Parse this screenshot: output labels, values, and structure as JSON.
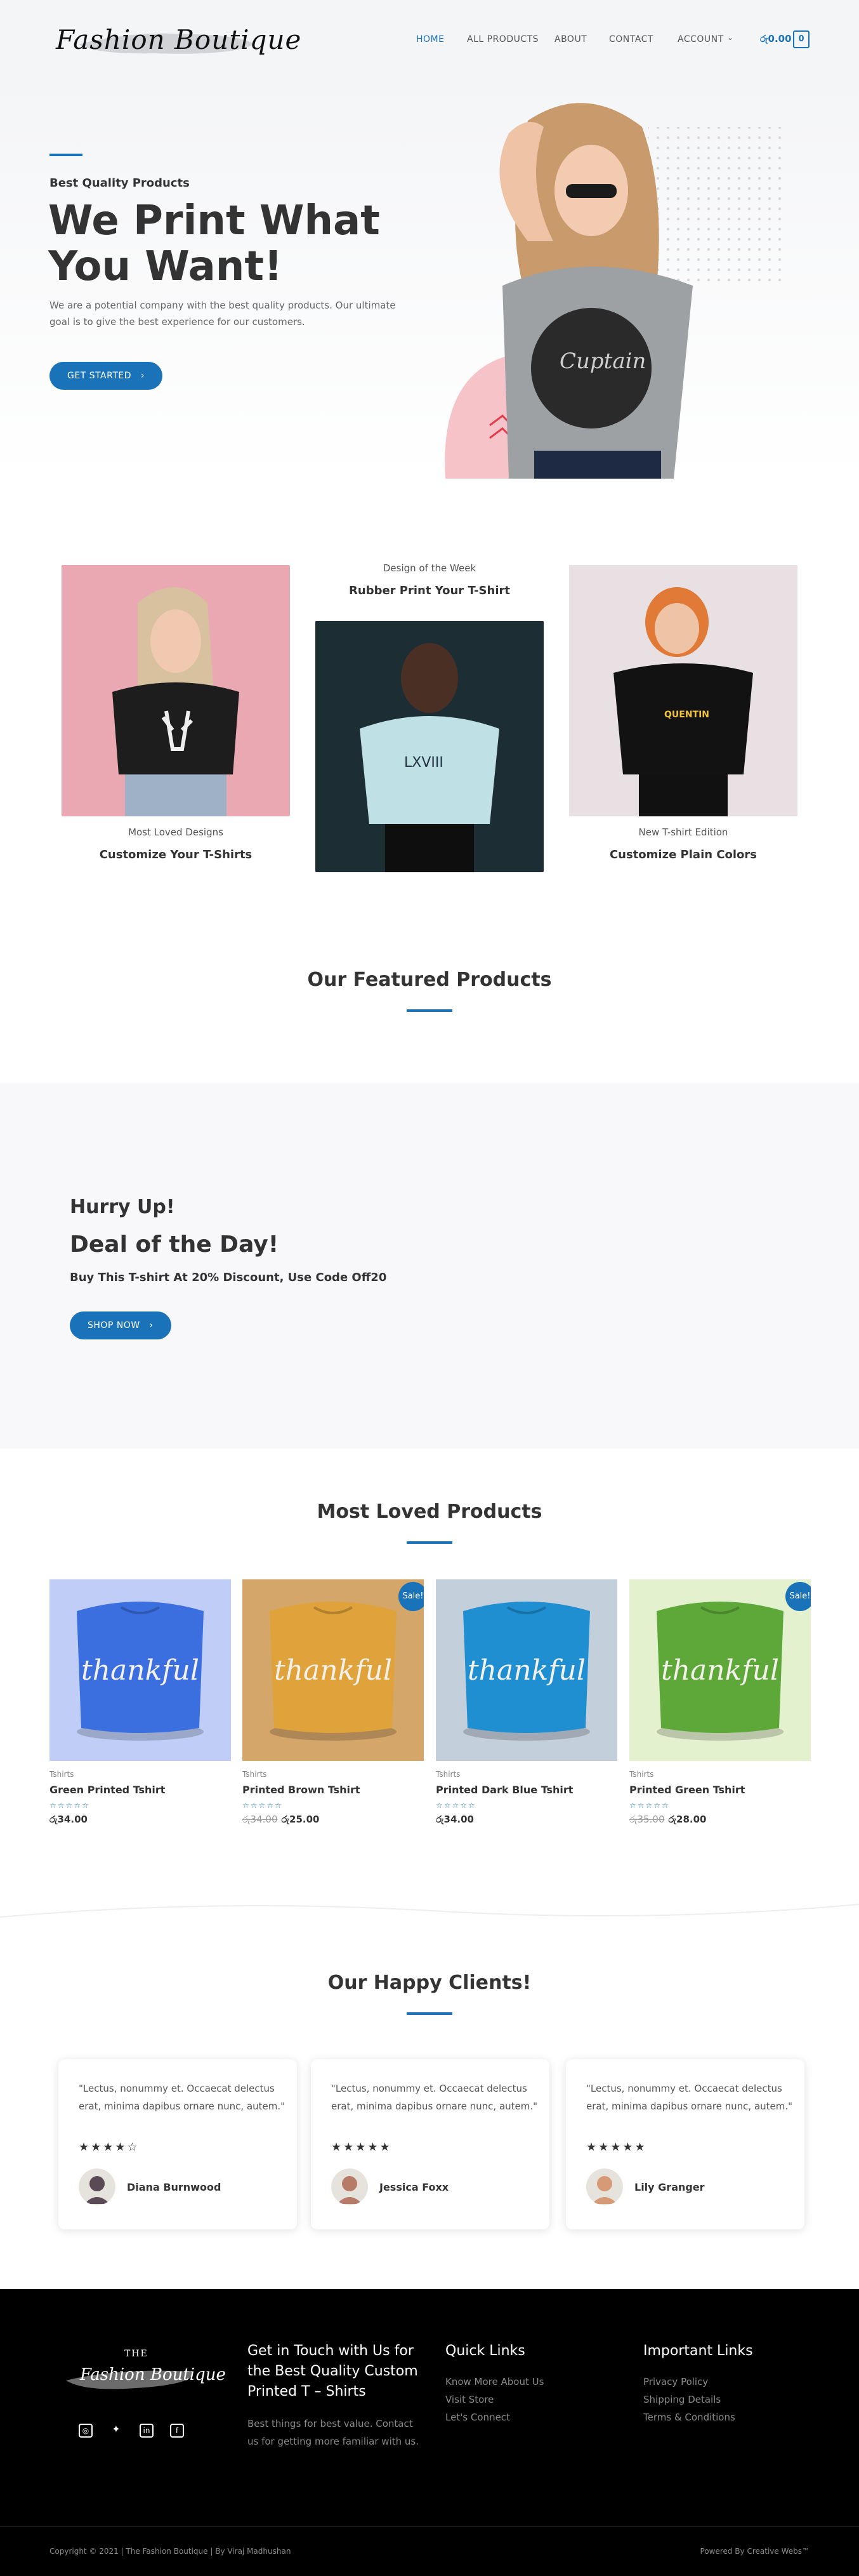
{
  "header": {
    "logo_text": "Fashion Boutique",
    "nav": [
      "HOME",
      "ALL PRODUCTS",
      "ABOUT",
      "CONTACT",
      "ACCOUNT"
    ],
    "cart_amount": "රු0.00",
    "cart_count": "0"
  },
  "hero": {
    "kicker": "Best Quality Products",
    "title": "We Print What You Want!",
    "description": "We are a potential company with the best quality products. Our ultimate goal is to give the best experience for our customers.",
    "button": "GET STARTED"
  },
  "designs": [
    {
      "subtitle": "Most Loved Designs",
      "title": "Customize Your T-Shirts"
    },
    {
      "subtitle": "Design of the Week",
      "title": "Rubber Print Your T-Shirt"
    },
    {
      "subtitle": "New T-shirt Edition",
      "title": "Customize Plain Colors"
    }
  ],
  "featured": {
    "title": "Our Featured Products"
  },
  "deal": {
    "hurry": "Hurry Up!",
    "title": "Deal of the Day!",
    "text": "Buy This T-shirt At 20% Discount, Use Code Off20",
    "button": "SHOP NOW"
  },
  "loved": {
    "title": "Most Loved Products",
    "products": [
      {
        "category": "Tshirts",
        "name": "Green Printed Tshirt",
        "old_price": "",
        "price": "රු34.00",
        "sale": "",
        "color": "#3b6fe0",
        "bg": "#bfcdf7",
        "print": "thankful"
      },
      {
        "category": "Tshirts",
        "name": "Printed Brown Tshirt",
        "old_price": "රු34.00",
        "price": "රු25.00",
        "sale": "Sale!",
        "color": "#e0a23a",
        "bg": "#d4a66a",
        "print": "thankful"
      },
      {
        "category": "Tshirts",
        "name": "Printed Dark Blue Tshirt",
        "old_price": "",
        "price": "රු34.00",
        "sale": "",
        "color": "#1f8fd1",
        "bg": "#c4cfdc",
        "print": "thankful"
      },
      {
        "category": "Tshirts",
        "name": "Printed Green Tshirt",
        "old_price": "රු35.00",
        "price": "රු28.00",
        "sale": "Sale!",
        "color": "#5ea83a",
        "bg": "#e3f1cf",
        "print": "thankful"
      }
    ],
    "stars": "☆☆☆☆☆"
  },
  "clients": {
    "title": "Our Happy Clients!",
    "items": [
      {
        "quote": "\"Lectus, nonummy et. Occaecat delectus erat, minima dapibus ornare nunc, autem.\"",
        "stars": "★★★★☆",
        "name": "Diana Burnwood"
      },
      {
        "quote": "\"Lectus, nonummy et. Occaecat delectus erat, minima dapibus ornare nunc, autem.\"",
        "stars": "★★★★★",
        "name": "Jessica Foxx"
      },
      {
        "quote": "\"Lectus, nonummy et. Occaecat delectus erat, minima dapibus ornare nunc, autem.\"",
        "stars": "★★★★★",
        "name": "Lily Granger"
      }
    ]
  },
  "footer": {
    "logo_the": "THE",
    "logo_text": "Fashion Boutique",
    "contact_title": "Get in Touch with Us for the Best Quality Custom Printed T – Shirts",
    "contact_text": "Best things for best value. Contact us for getting more familiar with us.",
    "quick_title": "Quick Links",
    "quick_links": [
      "Know More About Us",
      "Visit Store",
      "Let's Connect"
    ],
    "important_title": "Important Links",
    "important_links": [
      "Privacy Policy",
      "Shipping Details",
      "Terms & Conditions"
    ],
    "copyright": "Copyright © 2021 | The Fashion Boutique | By Viraj Madhushan",
    "powered": "Powered By Creative Webs™"
  },
  "colors": {
    "accent": "#1a73b8",
    "footer_bg": "#000000"
  }
}
